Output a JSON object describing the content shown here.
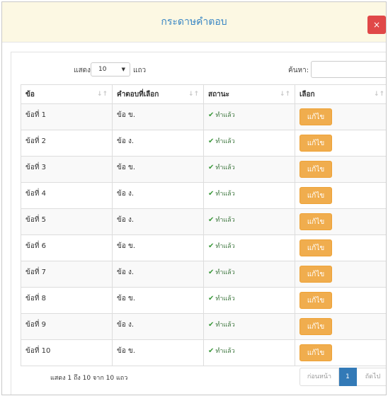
{
  "modal": {
    "title": "กระดาษคำตอบ",
    "close_label": "×"
  },
  "controls": {
    "length_label": "แสดง",
    "length_value": "10",
    "length_suffix": "แถว",
    "search_label": "ค้นหา:",
    "search_value": ""
  },
  "table": {
    "headers": [
      "ข้อ",
      "คำตอบที่เลือก",
      "สถานะ",
      "เลือก"
    ],
    "rows": [
      {
        "item": "ข้อที่ 1",
        "answer": "ข้อ ข.",
        "status": "ทำแล้ว",
        "action": "แก้ไข"
      },
      {
        "item": "ข้อที่ 2",
        "answer": "ข้อ ง.",
        "status": "ทำแล้ว",
        "action": "แก้ไข"
      },
      {
        "item": "ข้อที่ 3",
        "answer": "ข้อ ข.",
        "status": "ทำแล้ว",
        "action": "แก้ไข"
      },
      {
        "item": "ข้อที่ 4",
        "answer": "ข้อ ง.",
        "status": "ทำแล้ว",
        "action": "แก้ไข"
      },
      {
        "item": "ข้อที่ 5",
        "answer": "ข้อ ง.",
        "status": "ทำแล้ว",
        "action": "แก้ไข"
      },
      {
        "item": "ข้อที่ 6",
        "answer": "ข้อ ข.",
        "status": "ทำแล้ว",
        "action": "แก้ไข"
      },
      {
        "item": "ข้อที่ 7",
        "answer": "ข้อ ง.",
        "status": "ทำแล้ว",
        "action": "แก้ไข"
      },
      {
        "item": "ข้อที่ 8",
        "answer": "ข้อ ข.",
        "status": "ทำแล้ว",
        "action": "แก้ไข"
      },
      {
        "item": "ข้อที่ 9",
        "answer": "ข้อ ง.",
        "status": "ทำแล้ว",
        "action": "แก้ไข"
      },
      {
        "item": "ข้อที่ 10",
        "answer": "ข้อ ข.",
        "status": "ทำแล้ว",
        "action": "แก้ไข"
      }
    ]
  },
  "footer": {
    "info": "แสดง 1 ถึง 10 จาก 10 แถว",
    "prev_label": "ก่อนหน้า",
    "current_page": "1",
    "next_label": "ถัดไป"
  },
  "colors": {
    "header_bg": "#fcf8e3",
    "title": "#3a87c4",
    "close_button": "#e04848",
    "edit_button": "#f0ad4e",
    "status_ok": "#3c763d",
    "pager_active": "#337ab7"
  },
  "icons": {
    "close": "close-icon",
    "sort": "sort-icon",
    "check": "check-icon",
    "caret": "chevron-down-icon"
  }
}
